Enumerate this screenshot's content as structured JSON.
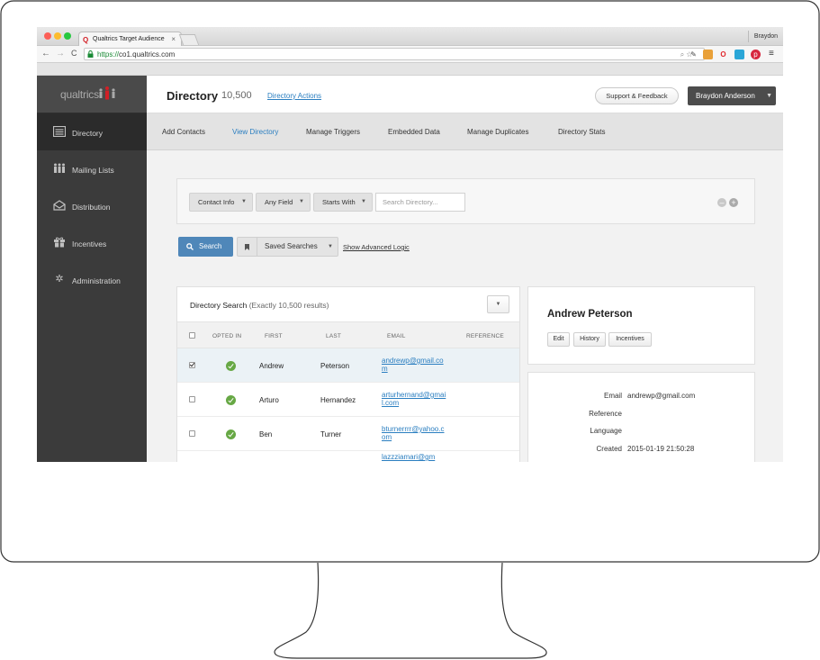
{
  "browser": {
    "tab_title": "Qualtrics Target Audience",
    "tab_close": "×",
    "profile_name": "Braydon",
    "url_scheme": "https://",
    "url_host": "co1.qualtrics.com",
    "icons": [
      "back-icon",
      "forward-icon",
      "reload-icon",
      "lock-icon",
      "search-icon",
      "star-icon",
      "menu-icon"
    ]
  },
  "sidebar": {
    "logo": "qualtrics",
    "items": [
      {
        "label": "Directory",
        "icon": "list-icon",
        "active": true
      },
      {
        "label": "Mailing Lists",
        "icon": "people-icon",
        "active": false
      },
      {
        "label": "Distribution",
        "icon": "envelope-icon",
        "active": false
      },
      {
        "label": "Incentives",
        "icon": "gift-icon",
        "active": false
      },
      {
        "label": "Administration",
        "icon": "gear-icon",
        "active": false
      }
    ]
  },
  "header": {
    "title": "Directory",
    "count": "10,500",
    "actions_link": "Directory Actions",
    "support_button": "Support & Feedback",
    "user_button": "Braydon Anderson"
  },
  "subnav": {
    "items": [
      {
        "label": "Add Contacts",
        "active": false
      },
      {
        "label": "View Directory",
        "active": true
      },
      {
        "label": "Manage Triggers",
        "active": false
      },
      {
        "label": "Embedded Data",
        "active": false
      },
      {
        "label": "Manage Duplicates",
        "active": false
      },
      {
        "label": "Directory Stats",
        "active": false
      }
    ]
  },
  "filters": {
    "field_group": "Contact Info",
    "field": "Any Field",
    "operator": "Starts With",
    "search_placeholder": "Search Directory..."
  },
  "search": {
    "search_button": "Search",
    "saved_searches": "Saved Searches",
    "advanced_logic": "Show Advanced Logic"
  },
  "results": {
    "title": "Directory Search",
    "count": "(Exactly 10,500 results)",
    "columns": [
      "OPTED IN",
      "FIRST",
      "LAST",
      "EMAIL",
      "REFERENCE"
    ],
    "rows": [
      {
        "checked": true,
        "opted_in": true,
        "first": "Andrew",
        "last": "Peterson",
        "email": "andrewp@gmail.com"
      },
      {
        "checked": false,
        "opted_in": true,
        "first": "Arturo",
        "last": "Hernandez",
        "email": "arturhernand@gmail.com"
      },
      {
        "checked": false,
        "opted_in": true,
        "first": "Ben",
        "last": "Turner",
        "email": "bturnerrrr@yahoo.com"
      },
      {
        "checked": false,
        "opted_in": true,
        "first": "",
        "last": "",
        "email": "lazzziamari@gm"
      }
    ]
  },
  "detail": {
    "name": "Andrew Peterson",
    "buttons": [
      "Edit",
      "History",
      "Incentives"
    ],
    "attributes": [
      {
        "key": "Email",
        "value": "andrewp@gmail.com"
      },
      {
        "key": "Reference",
        "value": ""
      },
      {
        "key": "Language",
        "value": ""
      },
      {
        "key": "Created",
        "value": "2015-01-19 21:50:28"
      }
    ]
  },
  "colors": {
    "sidebar": "#3b3b3b",
    "accent": "#2a7ec0",
    "search_button": "#4f87b9",
    "opted_in": "#67a845"
  }
}
